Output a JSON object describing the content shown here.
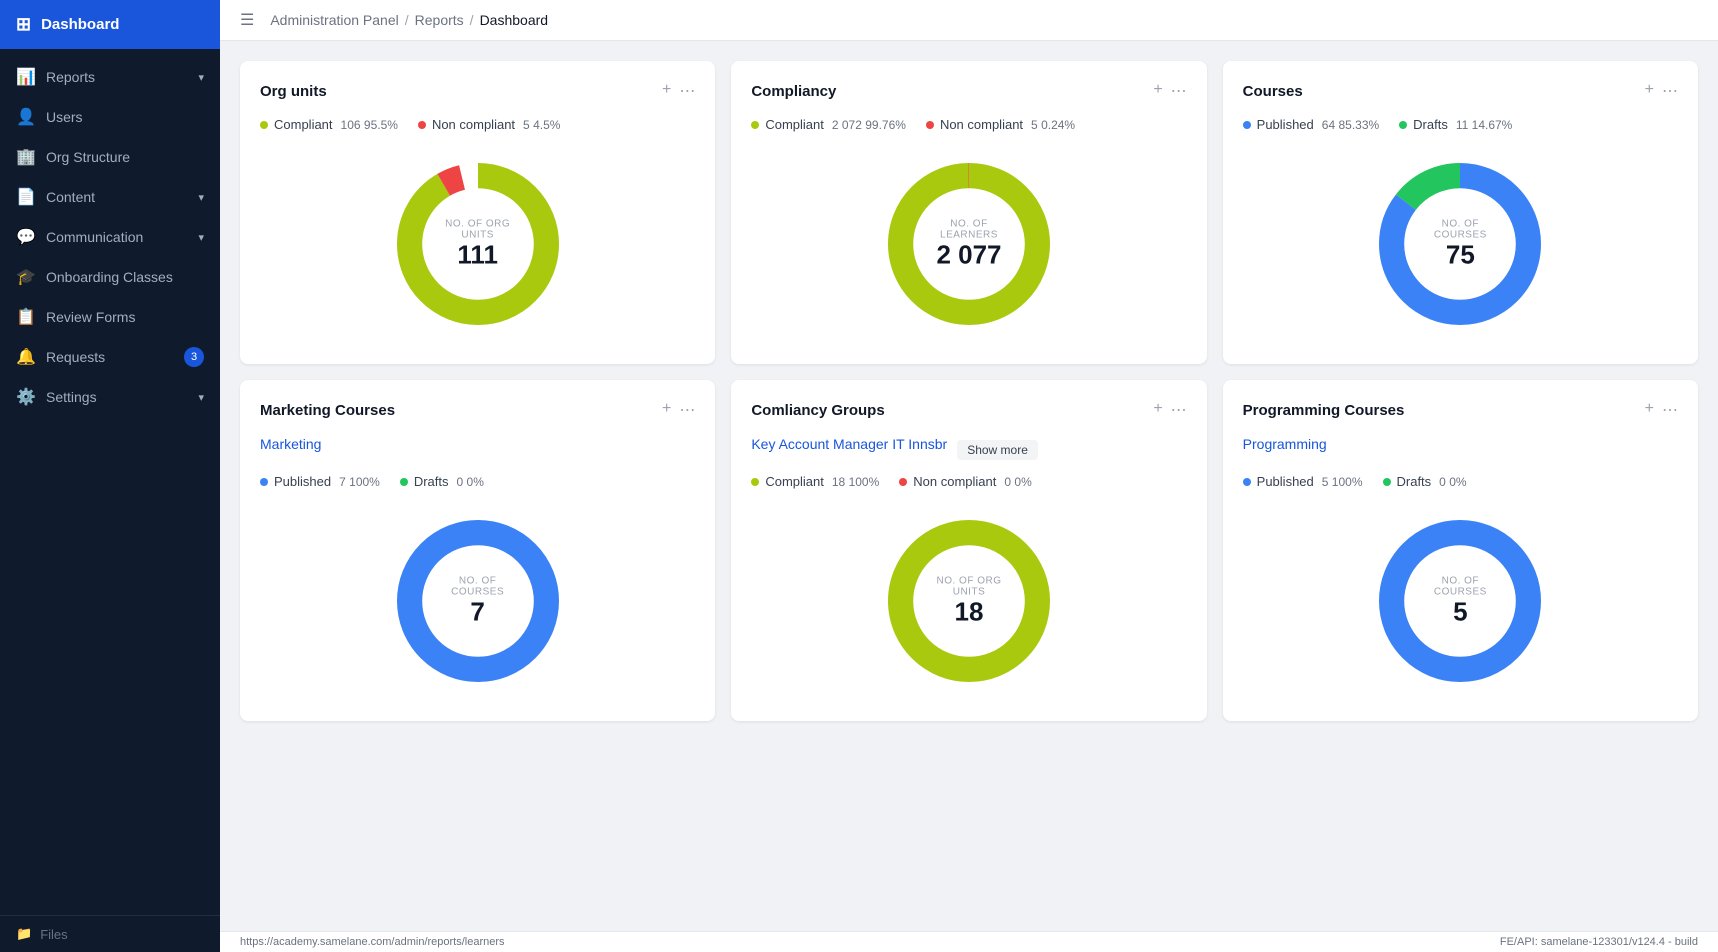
{
  "sidebar": {
    "app_title": "Dashboard",
    "items": [
      {
        "id": "reports",
        "label": "Reports",
        "icon": "📊",
        "has_chevron": true
      },
      {
        "id": "users",
        "label": "Users",
        "icon": "👤",
        "has_chevron": false
      },
      {
        "id": "org-structure",
        "label": "Org Structure",
        "icon": "🏢",
        "has_chevron": false
      },
      {
        "id": "content",
        "label": "Content",
        "icon": "📄",
        "has_chevron": true
      },
      {
        "id": "communication",
        "label": "Communication",
        "icon": "💬",
        "has_chevron": true
      },
      {
        "id": "onboarding",
        "label": "Onboarding Classes",
        "icon": "🎓",
        "has_chevron": false
      },
      {
        "id": "review-forms",
        "label": "Review Forms",
        "icon": "📋",
        "has_chevron": false
      },
      {
        "id": "requests",
        "label": "Requests",
        "icon": "🔔",
        "has_chevron": false,
        "badge": "3"
      },
      {
        "id": "settings",
        "label": "Settings",
        "icon": "⚙️",
        "has_chevron": true
      }
    ],
    "footer_label": "Files"
  },
  "breadcrumb": {
    "items": [
      "Administration Panel",
      "Reports",
      "Dashboard"
    ]
  },
  "cards": {
    "org_units": {
      "title": "Org units",
      "compliant": {
        "label": "Compliant",
        "count": "106",
        "pct": "95.5%"
      },
      "non_compliant": {
        "label": "Non compliant",
        "count": "5",
        "pct": "4.5%"
      },
      "center_label": "NO. OF ORG UNITS",
      "center_value": "111",
      "compliant_color": "#a8c90e",
      "non_compliant_color": "#ef4444"
    },
    "compliancy": {
      "title": "Compliancy",
      "compliant": {
        "label": "Compliant",
        "count": "2 072",
        "pct": "99.76%"
      },
      "non_compliant": {
        "label": "Non compliant",
        "count": "5",
        "pct": "0.24%"
      },
      "center_label": "NO. OF LEARNERS",
      "center_value": "2 077",
      "compliant_color": "#a8c90e",
      "non_compliant_color": "#ef4444"
    },
    "courses": {
      "title": "Courses",
      "published": {
        "label": "Published",
        "count": "64",
        "pct": "85.33%"
      },
      "drafts": {
        "label": "Drafts",
        "count": "11",
        "pct": "14.67%"
      },
      "center_label": "NO. OF COURSES",
      "center_value": "75",
      "published_color": "#3b82f6",
      "drafts_color": "#22c55e"
    },
    "marketing_courses": {
      "title": "Marketing Courses",
      "link_label": "Marketing",
      "published": {
        "label": "Published",
        "count": "7",
        "pct": "100%"
      },
      "drafts": {
        "label": "Drafts",
        "count": "0",
        "pct": "0%"
      },
      "center_label": "NO. OF COURSES",
      "center_value": "7",
      "published_color": "#3b82f6",
      "drafts_color": "#22c55e"
    },
    "compliancy_groups": {
      "title": "Comliancy Groups",
      "link_label": "Key Account Manager IT Innsbr",
      "show_more_label": "Show more",
      "compliant": {
        "label": "Compliant",
        "count": "18",
        "pct": "100%"
      },
      "non_compliant": {
        "label": "Non compliant",
        "count": "0",
        "pct": "0%"
      },
      "center_label": "NO. OF ORG UNITS",
      "center_value": "18",
      "compliant_color": "#a8c90e",
      "non_compliant_color": "#ef4444"
    },
    "programming_courses": {
      "title": "Programming Courses",
      "link_label": "Programming",
      "published": {
        "label": "Published",
        "count": "5",
        "pct": "100%"
      },
      "drafts": {
        "label": "Drafts",
        "count": "0",
        "pct": "0%"
      },
      "center_label": "NO. OF COURSES",
      "center_value": "5",
      "published_color": "#3b82f6",
      "drafts_color": "#22c55e"
    }
  },
  "status_bar": {
    "url": "https://academy.samelane.com/admin/reports/learners",
    "api_info": "FE/API: samelane-123301/v124.4 - build"
  },
  "icons": {
    "grid": "⊞",
    "plus": "+",
    "dots": "⋯",
    "hamburger": "☰"
  }
}
